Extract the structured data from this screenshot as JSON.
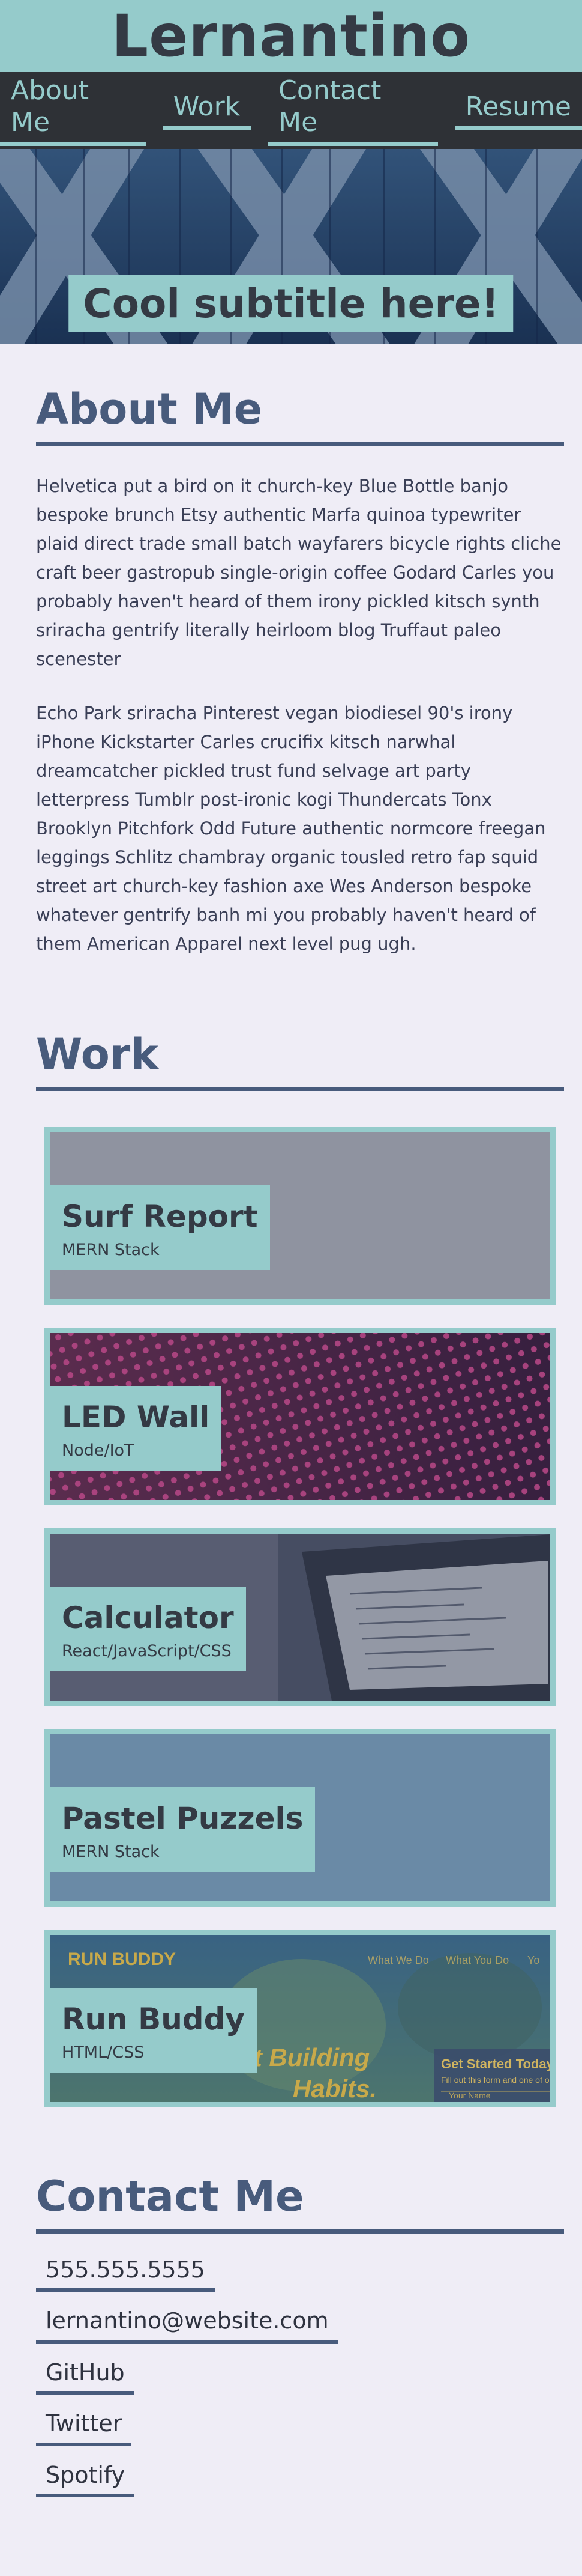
{
  "site": {
    "title": "Lernantino"
  },
  "nav": {
    "items": [
      {
        "label": "About Me"
      },
      {
        "label": "Work"
      },
      {
        "label": "Contact Me"
      },
      {
        "label": "Resume"
      }
    ]
  },
  "hero": {
    "subtitle": "Cool subtitle here!"
  },
  "about": {
    "heading": "About Me",
    "paragraphs": [
      "Helvetica put a bird on it church-key Blue Bottle banjo bespoke brunch Etsy authentic Marfa quinoa typewriter plaid direct trade small batch wayfarers bicycle rights cliche craft beer gastropub single-origin coffee Godard Carles you probably haven't heard of them irony pickled kitsch synth sriracha gentrify literally heirloom blog Truffaut paleo scenester",
      "Echo Park sriracha Pinterest vegan biodiesel 90's irony iPhone Kickstarter Carles crucifix kitsch narwhal dreamcatcher pickled trust fund selvage art party letterpress Tumblr post-ironic kogi Thundercats Tonx Brooklyn Pitchfork Odd Future authentic normcore freegan leggings Schlitz chambray organic tousled retro fap squid street art church-key fashion axe Wes Anderson bespoke whatever gentrify banh mi you probably haven't heard of them American Apparel next level pug ugh."
    ]
  },
  "work": {
    "heading": "Work",
    "projects": [
      {
        "name": "Surf Report",
        "stack": "MERN Stack",
        "image": "gray-placeholder"
      },
      {
        "name": "LED Wall",
        "stack": "Node/IoT",
        "image": "led-dots"
      },
      {
        "name": "Calculator",
        "stack": "React/JavaScript/CSS",
        "image": "laptop-code"
      },
      {
        "name": "Pastel Puzzels",
        "stack": "MERN Stack",
        "image": "blue-placeholder"
      },
      {
        "name": "Run Buddy",
        "stack": "HTML/CSS",
        "image": "run-buddy-site",
        "screenshot_text": {
          "logo": "RUN BUDDY",
          "nav": [
            "What We Do",
            "What You Do",
            "Yo"
          ],
          "headline_1": "art Building",
          "headline_2": "Habits.",
          "cta_title": "Get Started Today",
          "cta_sub": "Fill out this form and one of o",
          "cta_field": "Your Name"
        }
      }
    ]
  },
  "contact": {
    "heading": "Contact Me",
    "links": [
      {
        "label": "555.555.5555"
      },
      {
        "label": "lernantino@website.com"
      },
      {
        "label": "GitHub"
      },
      {
        "label": "Twitter"
      },
      {
        "label": "Spotify"
      }
    ]
  },
  "colors": {
    "accent": "#95cbcb",
    "dark": "#343a44",
    "navbar": "#2e3136",
    "heading": "#485b7c",
    "background": "#efedf6"
  }
}
